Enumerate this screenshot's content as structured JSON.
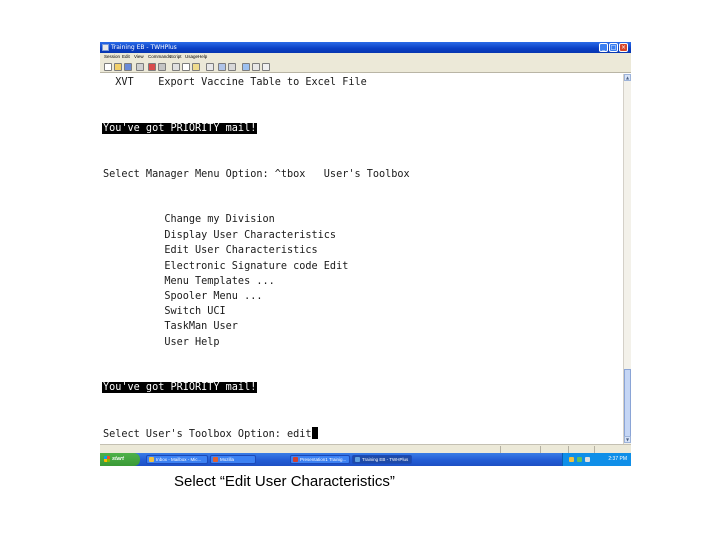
{
  "window": {
    "title": "Training EB - TWHPlus",
    "controls": {
      "minimize": "_",
      "maximize": "□",
      "close": "×"
    }
  },
  "menubar": [
    "Session",
    "Edit",
    "View",
    "Commands",
    "Script",
    "Usage",
    "Help"
  ],
  "toolbar_icons": [
    "new-icon",
    "open-icon",
    "save-icon",
    "print-icon",
    "connect-icon",
    "disconnect-icon",
    "cut-icon",
    "copy-icon",
    "paste-icon",
    "find-icon",
    "settings-icon",
    "keyboard-icon",
    "help-icon",
    "about-icon",
    "context-help-icon"
  ],
  "terminal": {
    "lines": [
      "  XVT    Export Vaccine Table to Excel File",
      "You've got PRIORITY mail!",
      "Select Manager Menu Option: ^tbox   User's Toolbox",
      "          Change my Division",
      "          Display User Characteristics",
      "          Edit User Characteristics",
      "          Electronic Signature code Edit",
      "          Menu Templates ...",
      "          Spooler Menu ...",
      "          Switch UCI",
      "          TaskMan User",
      "          User Help",
      "You've got PRIORITY mail!",
      "Select User's Toolbox Option: edit"
    ],
    "highlighted_lines": [
      1,
      12
    ],
    "cursor_line": 13
  },
  "taskbar": {
    "start_label": "start",
    "tasks": [
      {
        "label": "Inbox - Mailbox - Mic...",
        "icon_color": "#f0c040",
        "active": false
      },
      {
        "label": "Mozilla",
        "icon_color": "#e06030",
        "active": false
      },
      {
        "label": "Presentation1 Trainig...",
        "icon_color": "#d04030",
        "active": false
      },
      {
        "label": "Training EB - TWHPlus",
        "icon_color": "#60a0e0",
        "active": true
      }
    ],
    "clock": "2:37 PM"
  },
  "caption": "Select “Edit User Characteristics”"
}
